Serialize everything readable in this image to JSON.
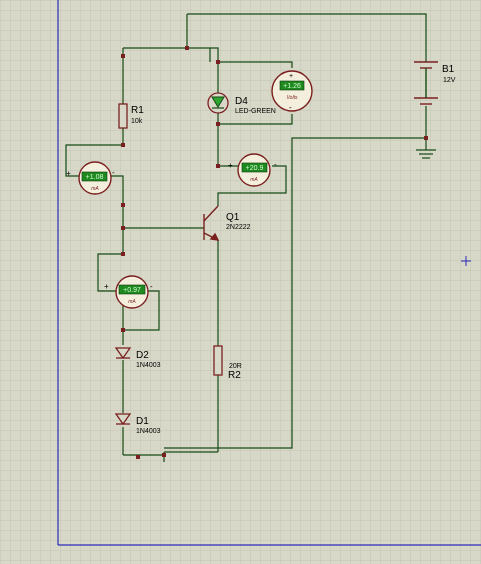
{
  "components": {
    "r1": {
      "ref": "R1",
      "value": "10k"
    },
    "r2": {
      "ref": "R2",
      "value": "20R"
    },
    "d4": {
      "ref": "D4",
      "value": "LED-GREEN"
    },
    "d2": {
      "ref": "D2",
      "value": "1N4003"
    },
    "d1": {
      "ref": "D1",
      "value": "1N4003"
    },
    "q1": {
      "ref": "Q1",
      "value": "2N2222"
    },
    "b1": {
      "ref": "B1",
      "value": "12V"
    }
  },
  "meters": {
    "voltmeter": {
      "reading": "+1.26",
      "unit": "Volts",
      "plus": "+",
      "minus": "-"
    },
    "ammeter_base": {
      "reading": "+1.08",
      "unit": "mA",
      "plus": "+",
      "minus": "-"
    },
    "ammeter_collector": {
      "reading": "+20.9",
      "unit": "mA",
      "plus": "+",
      "minus": "-"
    },
    "ammeter_diode": {
      "reading": "+0.97",
      "unit": "mA",
      "plus": "+",
      "minus": "-"
    }
  },
  "colors": {
    "background": "#d8d8c8",
    "grid": "#c2c2b2",
    "frame": "#2b2bb8",
    "wire": "#154a15",
    "component": "#7a1f1f",
    "label": "#000000",
    "meter_face": "#f4eedd",
    "meter_display": "#1f8a1f",
    "meter_text": "#d6ffd6",
    "led_fill": "#2fa52f",
    "cursor": "#2b2bb8"
  }
}
